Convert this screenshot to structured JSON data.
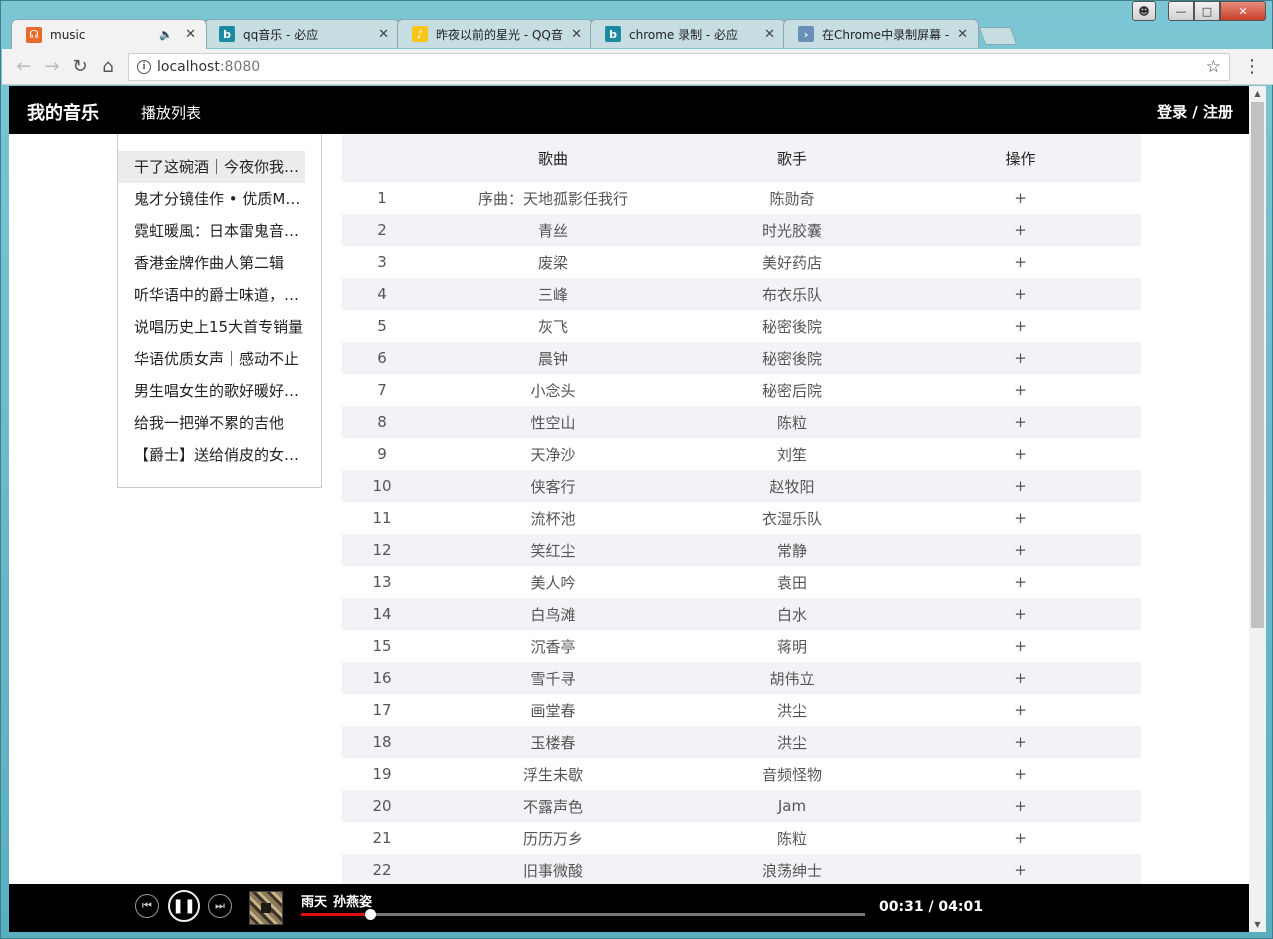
{
  "browser": {
    "tabs": [
      {
        "title": "music",
        "favicon_color": "#e8692a",
        "favicon_glyph": "☊",
        "audio": true,
        "active": true
      },
      {
        "title": "qq音乐 - 必应",
        "favicon_color": "#1c8ba0",
        "favicon_glyph": "b",
        "audio": false,
        "active": false
      },
      {
        "title": "昨夜以前的星光 - QQ音",
        "favicon_color": "#f5c518",
        "favicon_glyph": "♪",
        "audio": false,
        "active": false
      },
      {
        "title": "chrome 录制 - 必应",
        "favicon_color": "#1c8ba0",
        "favicon_glyph": "b",
        "audio": false,
        "active": false
      },
      {
        "title": "在Chrome中录制屏幕 - ",
        "favicon_color": "#6a8fb8",
        "favicon_glyph": "›",
        "audio": false,
        "active": false
      }
    ],
    "url_host": "localhost",
    "url_port": ":8080"
  },
  "header": {
    "brand": "我的音乐",
    "nav_playlist": "播放列表",
    "auth": "登录 / 注册"
  },
  "playlists": [
    "干了这碗酒｜今夜你我不醉不归",
    "鬼才分镜佳作 • 优质MV推荐",
    "霓虹暖風：日本雷鬼音乐精选",
    "香港金牌作曲人第二辑",
    "听华语中的爵士味道，浪漫慵懒",
    "说唱历史上15大首专销量",
    "华语优质女声｜感动不止",
    "男生唱女生的歌好暖好温柔",
    "给我一把弹不累的吉他",
    "【爵士】送给俏皮的女孩们"
  ],
  "table": {
    "headers": {
      "song": "歌曲",
      "singer": "歌手",
      "op": "操作"
    },
    "rows": [
      {
        "idx": "1",
        "song": "序曲：天地孤影任我行",
        "singer": "陈勋奇",
        "op": "+"
      },
      {
        "idx": "2",
        "song": "青丝",
        "singer": "时光胶囊",
        "op": "+"
      },
      {
        "idx": "3",
        "song": "废梁",
        "singer": "美好药店",
        "op": "+"
      },
      {
        "idx": "4",
        "song": "三峰",
        "singer": "布衣乐队",
        "op": "+"
      },
      {
        "idx": "5",
        "song": "灰飞",
        "singer": "秘密後院",
        "op": "+"
      },
      {
        "idx": "6",
        "song": "晨钟",
        "singer": "秘密後院",
        "op": "+"
      },
      {
        "idx": "7",
        "song": "小念头",
        "singer": "秘密后院",
        "op": "+"
      },
      {
        "idx": "8",
        "song": "性空山",
        "singer": "陈粒",
        "op": "+"
      },
      {
        "idx": "9",
        "song": "天净沙",
        "singer": "刘笙",
        "op": "+"
      },
      {
        "idx": "10",
        "song": "侠客行",
        "singer": "赵牧阳",
        "op": "+"
      },
      {
        "idx": "11",
        "song": "流杯池",
        "singer": "衣湿乐队",
        "op": "+"
      },
      {
        "idx": "12",
        "song": "笑红尘",
        "singer": "常静",
        "op": "+"
      },
      {
        "idx": "13",
        "song": "美人吟",
        "singer": "袁田",
        "op": "+"
      },
      {
        "idx": "14",
        "song": "白鸟滩",
        "singer": "白水",
        "op": "+"
      },
      {
        "idx": "15",
        "song": "沉香亭",
        "singer": "蒋明",
        "op": "+"
      },
      {
        "idx": "16",
        "song": "雪千寻",
        "singer": "胡伟立",
        "op": "+"
      },
      {
        "idx": "17",
        "song": "画堂春",
        "singer": "洪尘",
        "op": "+"
      },
      {
        "idx": "18",
        "song": "玉楼春",
        "singer": "洪尘",
        "op": "+"
      },
      {
        "idx": "19",
        "song": "浮生未歇",
        "singer": "音频怪物",
        "op": "+"
      },
      {
        "idx": "20",
        "song": "不露声色",
        "singer": "Jam",
        "op": "+"
      },
      {
        "idx": "21",
        "song": "历历万乡",
        "singer": "陈粒",
        "op": "+"
      },
      {
        "idx": "22",
        "song": "旧事微酸",
        "singer": "浪荡绅士",
        "op": "+"
      }
    ]
  },
  "player": {
    "song": "雨天",
    "artist": "孙燕姿",
    "current_time": "00:31",
    "total_time": "04:01",
    "time_text": "00:31 / 04:01",
    "progress": 0.122,
    "accent_color": "#e01010"
  }
}
